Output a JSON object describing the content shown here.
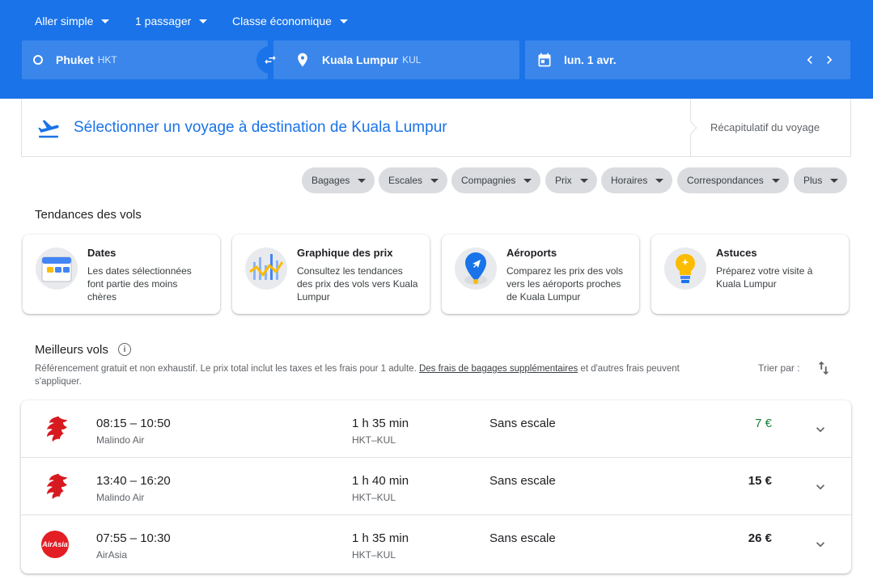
{
  "toolbar": {
    "trip_type": "Aller simple",
    "passengers": "1 passager",
    "cabin_class": "Classe économique"
  },
  "search": {
    "origin_city": "Phuket",
    "origin_code": "HKT",
    "destination_city": "Kuala Lumpur",
    "destination_code": "KUL",
    "date": "lun. 1 avr."
  },
  "select": {
    "title": "Sélectionner un voyage à destination de Kuala Lumpur",
    "summary": "Récapitulatif du voyage"
  },
  "filters": [
    "Bagages",
    "Escales",
    "Compagnies",
    "Prix",
    "Horaires",
    "Correspondances",
    "Plus"
  ],
  "trends": {
    "title": "Tendances des vols",
    "cards": [
      {
        "title": "Dates",
        "desc": "Les dates sélectionnées font partie des moins chères",
        "icon": "calendar-icon"
      },
      {
        "title": "Graphique des prix",
        "desc": "Consultez les tendances des prix des vols vers Kuala Lumpur",
        "icon": "price-graph-icon"
      },
      {
        "title": "Aéroports",
        "desc": "Comparez les prix des vols vers les aéroports proches de Kuala Lumpur",
        "icon": "airport-pin-icon"
      },
      {
        "title": "Astuces",
        "desc": "Préparez votre visite à Kuala Lumpur",
        "icon": "lightbulb-icon"
      }
    ]
  },
  "best": {
    "title": "Meilleurs vols",
    "disclaimer_before": "Référencement gratuit et non exhaustif. Le prix total inclut les taxes et les frais pour 1 adulte. ",
    "disclaimer_link": "Des frais de bagages supplémentaires",
    "disclaimer_after": " et d'autres frais peuvent s'appliquer.",
    "sort_label": "Trier par :"
  },
  "flights": [
    {
      "times": "08:15 – 10:50",
      "airline": "Malindo Air",
      "duration": "1 h 35 min",
      "route": "HKT–KUL",
      "stops": "Sans escale",
      "price": "7 €",
      "logo": "malindo-logo"
    },
    {
      "times": "13:40 – 16:20",
      "airline": "Malindo Air",
      "duration": "1 h 40 min",
      "route": "HKT–KUL",
      "stops": "Sans escale",
      "price": "15 €",
      "logo": "malindo-logo"
    },
    {
      "times": "07:55 – 10:30",
      "airline": "AirAsia",
      "duration": "1 h 35 min",
      "route": "HKT–KUL",
      "stops": "Sans escale",
      "price": "26 €",
      "logo": "airasia-logo"
    }
  ],
  "colors": {
    "header_blue": "#1a73e8",
    "low_price_green": "#188038",
    "chip_gray": "#dadce0"
  }
}
